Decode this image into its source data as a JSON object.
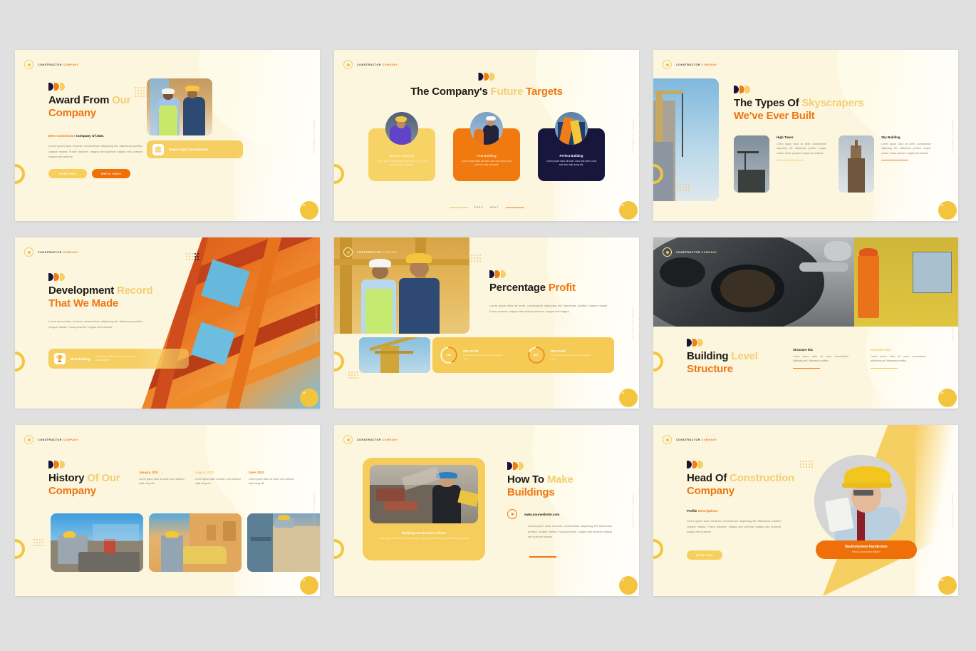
{
  "brand": {
    "part1": "CONSTRUCTOR ",
    "part2": "COMPANY",
    "icon": "gear-circle-icon"
  },
  "colors": {
    "page_bg": "#e0e0e0",
    "slide_bg": "#fdf6df",
    "accent_orange": "#ee7612",
    "accent_orange_dark": "#ef7009",
    "accent_yellow": "#f6cf63",
    "accent_light_yellow": "#f3cf74",
    "navy": "#16143a",
    "body_text": "#8e8878",
    "heading_text": "#1d1b16"
  },
  "side_label": "CONSTRUCTOR COMPANY",
  "slides": [
    {
      "number": "10",
      "title_plain": "Award From ",
      "title_light": "Our",
      "title_orange": "Company",
      "subtitle_orange": "Best Constructor",
      "subtitle_dark": " Company Of 2021",
      "body": "Lorem ipsum dolor sit amet, consectetuer adipiscing elit. Maecenas porttitor congue massa. Fusce posuere, magna sed pulvinar magna sed pulvinar magna sed pulvinar",
      "buttons": [
        {
          "label": "MORE INFO",
          "style": "light"
        },
        {
          "label": "CHECK VIDEO",
          "style": "dark"
        }
      ],
      "chip": {
        "label": "Mega Project Development",
        "icon": "bank-building-icon"
      }
    },
    {
      "number": "11",
      "title_plain": "The Company's ",
      "title_light": "Future",
      "title_orange": "Targets",
      "cards": [
        {
          "title": "Modern Building",
          "body": "Lorem ipsum dolor sit amet, cons ecte amet, cons ecte tuer adip iscing elit.",
          "style": "light"
        },
        {
          "title": "Fast Building",
          "body": "Lorem ipsum dolor sit amet, cons ecte amet, cons ecte tuer adip iscing elit.",
          "style": "orange"
        },
        {
          "title": "Perfect Building",
          "body": "Lorem ipsum dolor sit amet, cons ecte amet, cons ecte tuer adip iscing elit.",
          "style": "navy"
        }
      ],
      "nav": {
        "prev": "PREV",
        "next": "NEXT"
      }
    },
    {
      "number": "12",
      "title_plain": "The Types Of ",
      "title_light": "Skyscrapers",
      "title_orange": "We've Ever Built",
      "columns": [
        {
          "title": "High Tower",
          "body": "Lorem ipsum dolor sit amet, consectetuer adipiscing elit. Maecenas porttitor congue massa. Fusce posuere, magna sed pulvinar",
          "rule": "light"
        },
        {
          "title": "Sky Building",
          "body": "Lorem ipsum dolor sit amet, consectetuer adipiscing elit. Maecenas porttitor congue massa. Fusce posuere, magna sed pulvinar",
          "rule": "orange"
        }
      ]
    },
    {
      "number": "13",
      "title_plain": "Development ",
      "title_light": "Record",
      "title_orange": "That We Made",
      "body": "Lorem ipsum dolor sit amet, consectetuer adipiscing elit. Maecenas porttitor congue massa. Fusce posuere, magna sed pulvinar",
      "chip": {
        "label": "Best Building",
        "icon": "trophy-icon",
        "body": "Lorem ipsum dolor sit amet, consectetuer adipiscing elit"
      }
    },
    {
      "number": "14",
      "title_plain": "Percentage ",
      "title_orange": "Profit",
      "body": "Lorem ipsum dolor sit amet, consectetuer adipiscing elit. Maecenas porttitor congue massa. Fusce posuere, magna sed pulvinar posuere, magna sed magna.",
      "stats": [
        {
          "value": "43%",
          "percent": 43,
          "label": "2021 Profit",
          "body": "Lorem ipsum dolor sit amet, cons ectetuer adipis"
        },
        {
          "value": "80%",
          "percent": 80,
          "label": "2022 Profit",
          "body": "Lorem ipsum dolor sit amet, cons ectetuer adipis"
        }
      ]
    },
    {
      "number": "15",
      "title_plain": "Building ",
      "title_light": "Level",
      "title_orange": "Structure",
      "columns": [
        {
          "title": "Structure 001",
          "body": "Lorem ipsum dolor sit amet, consectetuer adipiscing elit. Maecenas porttitor",
          "rule": "orange"
        },
        {
          "title": "Structure 002",
          "body": "Lorem ipsum dolor sit amet, consectetuer adipiscing elit. Maecenas porttitor",
          "rule": "light"
        }
      ]
    },
    {
      "number": "16",
      "title_plain": "History ",
      "title_light": "Of Our",
      "title_orange": "Company",
      "timeline": [
        {
          "date": "January, 2021",
          "body": "Lorem ipsum dolor sit amet, cons ectetuer adipi scing elit.",
          "style": "orange"
        },
        {
          "date": "August, 2022",
          "body": "Lorem ipsum dolor sit amet, cons ectetuer adipi scing elit.",
          "style": "light"
        },
        {
          "date": "June, 2023",
          "body": "Lorem ipsum dolor sit amet, cons ectetuer adipi scing elit.",
          "style": "orange"
        }
      ]
    },
    {
      "number": "17",
      "title_plain": "How To ",
      "title_light": "Make",
      "title_orange": "Buildings",
      "website": "www.yourwebsite.com",
      "body": "Lorem ipsum dolor sit amet, consectetuer adipiscing elit. Maecenas porttitor congue massa. Fusce posuere, magna sed pulvinar magna sed pulvinar magna",
      "video_card": {
        "title": "Building Construction Videos",
        "body": "Lorem ipsum dolor sit amet, consectetuer adipiscing elit. Maecenas porttitor congue massa.",
        "icon": "play-circle-icon"
      }
    },
    {
      "number": "18",
      "title_plain": "Head Of ",
      "title_light": "Construction",
      "title_orange": "Company",
      "subtitle_dark": "Profile ",
      "subtitle_orange": "Descriptions",
      "body": "Lorem ipsum dolor sit amet, consectetuer adipiscing elit. Maecenas porttitor congue massa. Fusce posuere, magna sed pulvinar magna sed pulvinar magna sed pulvinar",
      "button": {
        "label": "MORE INFO",
        "style": "light"
      },
      "person": {
        "name": "Bartholomew Henderson",
        "role": "Head Construction Worker"
      }
    }
  ]
}
